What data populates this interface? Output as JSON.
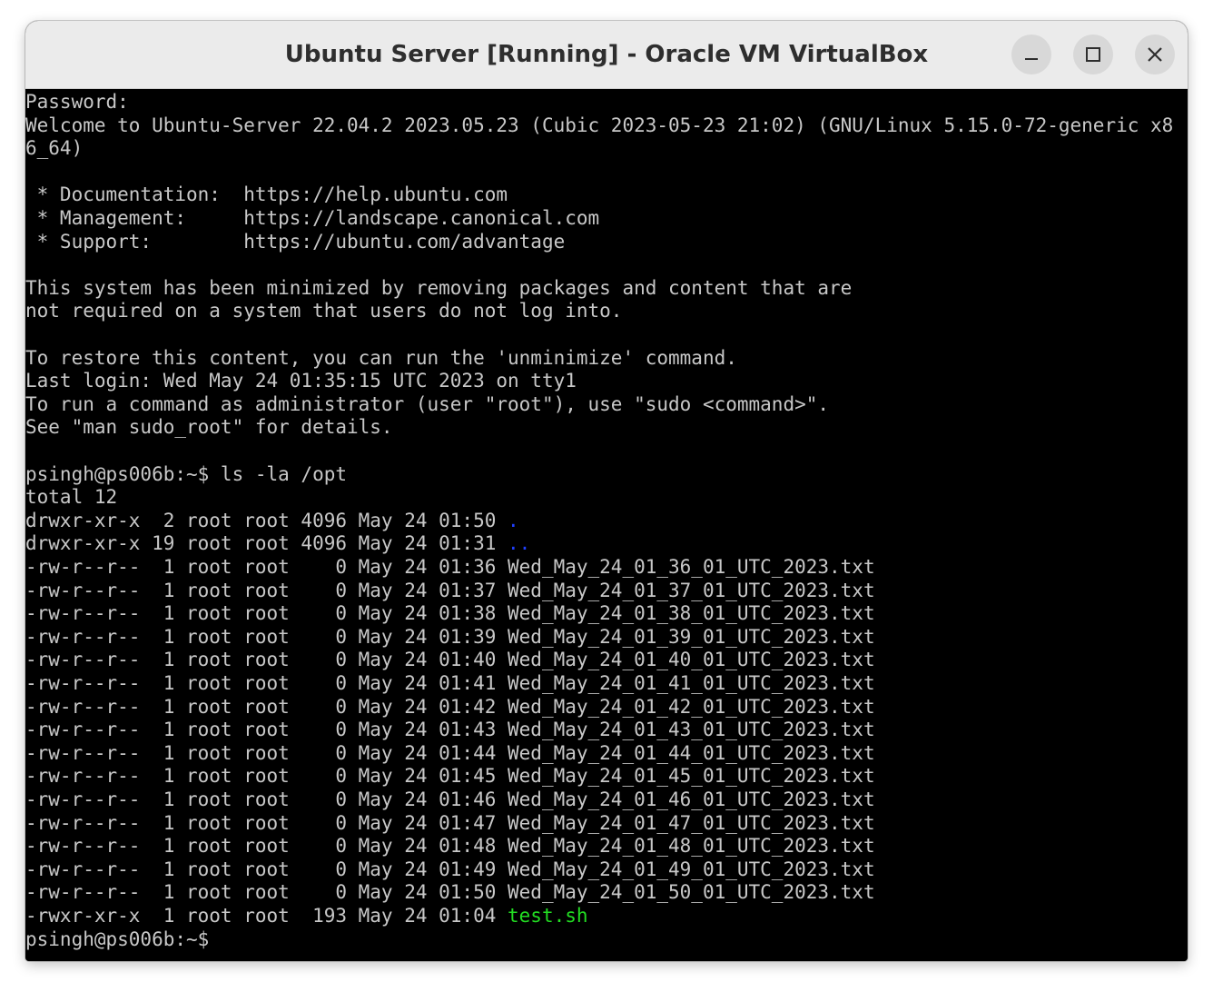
{
  "window": {
    "title": "Ubuntu Server [Running] - Oracle VM VirtualBox",
    "buttons": {
      "minimize": "minimize-icon",
      "maximize": "maximize-icon",
      "close": "close-icon"
    }
  },
  "colors": {
    "terminal_bg": "#000000",
    "terminal_fg": "#c8c8c8",
    "directory": "#2040ff",
    "executable": "#22dd22"
  },
  "terminal": {
    "banner": [
      "Password:",
      "Welcome to Ubuntu-Server 22.04.2 2023.05.23 (Cubic 2023-05-23 21:02) (GNU/Linux 5.15.0-72-generic x8",
      "6_64)",
      "",
      " * Documentation:  https://help.ubuntu.com",
      " * Management:     https://landscape.canonical.com",
      " * Support:        https://ubuntu.com/advantage",
      "",
      "This system has been minimized by removing packages and content that are",
      "not required on a system that users do not log into.",
      "",
      "To restore this content, you can run the 'unminimize' command.",
      "Last login: Wed May 24 01:35:15 UTC 2023 on tty1",
      "To run a command as administrator (user \"root\"), use \"sudo <command>\".",
      "See \"man sudo_root\" for details.",
      ""
    ],
    "command": "psingh@ps006b:~$ ls -la /opt",
    "total": "total 12",
    "entries": [
      {
        "meta": "drwxr-xr-x  2 root root 4096 May 24 01:50 ",
        "name": ".",
        "kind": "dir"
      },
      {
        "meta": "drwxr-xr-x 19 root root 4096 May 24 01:31 ",
        "name": "..",
        "kind": "dir"
      },
      {
        "meta": "-rw-r--r--  1 root root    0 May 24 01:36 ",
        "name": "Wed_May_24_01_36_01_UTC_2023.txt",
        "kind": "file"
      },
      {
        "meta": "-rw-r--r--  1 root root    0 May 24 01:37 ",
        "name": "Wed_May_24_01_37_01_UTC_2023.txt",
        "kind": "file"
      },
      {
        "meta": "-rw-r--r--  1 root root    0 May 24 01:38 ",
        "name": "Wed_May_24_01_38_01_UTC_2023.txt",
        "kind": "file"
      },
      {
        "meta": "-rw-r--r--  1 root root    0 May 24 01:39 ",
        "name": "Wed_May_24_01_39_01_UTC_2023.txt",
        "kind": "file"
      },
      {
        "meta": "-rw-r--r--  1 root root    0 May 24 01:40 ",
        "name": "Wed_May_24_01_40_01_UTC_2023.txt",
        "kind": "file"
      },
      {
        "meta": "-rw-r--r--  1 root root    0 May 24 01:41 ",
        "name": "Wed_May_24_01_41_01_UTC_2023.txt",
        "kind": "file"
      },
      {
        "meta": "-rw-r--r--  1 root root    0 May 24 01:42 ",
        "name": "Wed_May_24_01_42_01_UTC_2023.txt",
        "kind": "file"
      },
      {
        "meta": "-rw-r--r--  1 root root    0 May 24 01:43 ",
        "name": "Wed_May_24_01_43_01_UTC_2023.txt",
        "kind": "file"
      },
      {
        "meta": "-rw-r--r--  1 root root    0 May 24 01:44 ",
        "name": "Wed_May_24_01_44_01_UTC_2023.txt",
        "kind": "file"
      },
      {
        "meta": "-rw-r--r--  1 root root    0 May 24 01:45 ",
        "name": "Wed_May_24_01_45_01_UTC_2023.txt",
        "kind": "file"
      },
      {
        "meta": "-rw-r--r--  1 root root    0 May 24 01:46 ",
        "name": "Wed_May_24_01_46_01_UTC_2023.txt",
        "kind": "file"
      },
      {
        "meta": "-rw-r--r--  1 root root    0 May 24 01:47 ",
        "name": "Wed_May_24_01_47_01_UTC_2023.txt",
        "kind": "file"
      },
      {
        "meta": "-rw-r--r--  1 root root    0 May 24 01:48 ",
        "name": "Wed_May_24_01_48_01_UTC_2023.txt",
        "kind": "file"
      },
      {
        "meta": "-rw-r--r--  1 root root    0 May 24 01:49 ",
        "name": "Wed_May_24_01_49_01_UTC_2023.txt",
        "kind": "file"
      },
      {
        "meta": "-rw-r--r--  1 root root    0 May 24 01:50 ",
        "name": "Wed_May_24_01_50_01_UTC_2023.txt",
        "kind": "file"
      },
      {
        "meta": "-rwxr-xr-x  1 root root  193 May 24 01:04 ",
        "name": "test.sh",
        "kind": "exec"
      }
    ],
    "prompt": "psingh@ps006b:~$ "
  }
}
